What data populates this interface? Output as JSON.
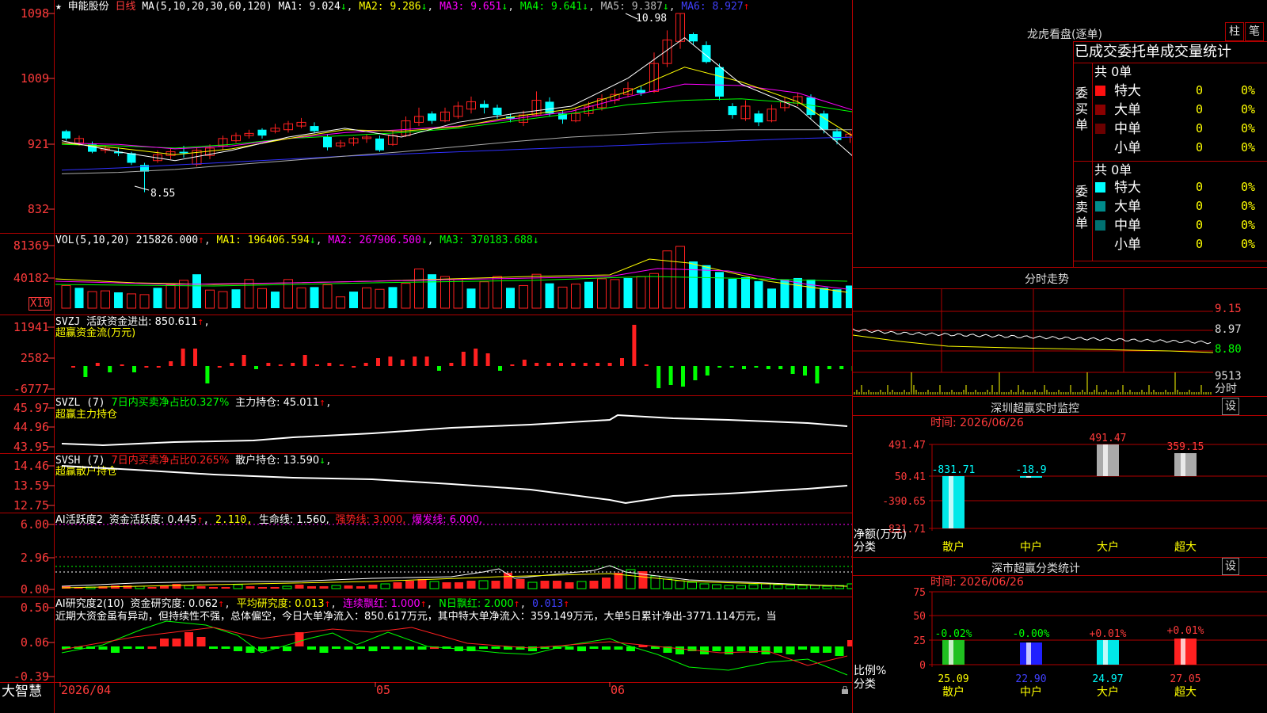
{
  "app": {
    "brand": "大智慧"
  },
  "main": {
    "star": "★",
    "stock_name": "申能股份",
    "period": "日线",
    "ma_label": "MA(5,10,20,30,60,120)",
    "ma1": "MA1: 9.024",
    "ma2": "MA2: 9.286",
    "ma3": "MA3: 9.651",
    "ma4": "MA4: 9.641",
    "ma5": "MA5: 9.387",
    "ma6": "MA6: 8.927",
    "high_label": "10.98",
    "low_label": "8.55",
    "y_ticks": [
      "1098",
      "1009",
      "921",
      "832"
    ],
    "colors": {
      "up": "#ff2020",
      "down": "#00ffff",
      "ma1": "#ffffff",
      "ma2": "#ffff00",
      "ma3": "#ff00ff",
      "ma4": "#00ff00",
      "ma5": "#aaaaaa",
      "ma6": "#3030ff"
    }
  },
  "vol": {
    "label": "VOL(5,10,20)",
    "value": "215826.000",
    "ma1": "MA1: 196406.594",
    "ma2": "MA2: 267906.500",
    "ma3": "MA3: 370183.688",
    "y_ticks": [
      "81369",
      "40182"
    ],
    "unit": "X10"
  },
  "svzj": {
    "label": "SVZJ",
    "desc": "活跃资金进出: 850.611",
    "subtitle": "超赢资金流(万元)",
    "y_ticks": [
      "11941",
      "2582",
      "-6777"
    ]
  },
  "svzl": {
    "label": "SVZL (7)",
    "desc": "7日内买卖净占比0.327%",
    "hold": "主力持仓: 45.011",
    "subtitle": "超赢主力持仓",
    "y_ticks": [
      "45.97",
      "44.96",
      "43.95"
    ]
  },
  "svsh": {
    "label": "SVSH (7)",
    "desc": "7日内买卖净占比0.265%",
    "hold": "散户持仓: 13.590",
    "subtitle": "超赢散户持仓",
    "y_ticks": [
      "14.46",
      "13.59",
      "12.75"
    ]
  },
  "ai1": {
    "label": "AI活跃度2",
    "desc": "资金活跃度: 0.445",
    "v2": "2.110,",
    "life": "生命线: 1.560,",
    "strong": "强势线: 3.000,",
    "burst": "爆发线: 6.000,",
    "y_ticks": [
      "6.00",
      "2.96",
      "0.00"
    ]
  },
  "ai2": {
    "label": "AI研究度2(10)",
    "desc": "资金研究度: 0.062",
    "avg": "平均研究度: 0.013",
    "cont": "连续飘红: 1.000",
    "nday": "N日飘红: 2.000",
    "last": "0.013",
    "comment": "近期大资金虽有异动，但持续性不强，总体偏空，今日大单净流入：850.617万元，其中特大单净流入：359.149万元，大单5日累计净出-3771.114万元，当",
    "y_ticks": [
      "0.50",
      "0.06",
      "-0.39"
    ]
  },
  "xaxis": {
    "labels": [
      "2026/04",
      "05",
      "06"
    ]
  },
  "right": {
    "lhb": {
      "title": "龙虎看盘(逐单)",
      "tab1": "柱",
      "tab2": "笔",
      "header": "已成交委托单成交量统计",
      "buy_side": "委买单",
      "sell_side": "委卖单",
      "buy_total": "共 0单",
      "sell_total": "共 0单",
      "rows": [
        {
          "name": "特大",
          "count": "0",
          "pct": "0%"
        },
        {
          "name": "大单",
          "count": "0",
          "pct": "0%"
        },
        {
          "name": "中单",
          "count": "0",
          "pct": "0%"
        },
        {
          "name": "小单",
          "count": "0",
          "pct": "0%"
        }
      ]
    },
    "intraday": {
      "title": "分时走势",
      "prices": [
        "9.15",
        "8.97",
        "8.80"
      ],
      "vol": "9513",
      "unit": "分时"
    },
    "monitor": {
      "title": "深圳超赢实时监控",
      "btn": "设",
      "time": "时间: 2026/06/26",
      "y_ticks": [
        "491.47",
        "50.41",
        "-390.65",
        "-831.71"
      ],
      "y_title": "净额(万元)",
      "x_title": "分类",
      "categories": [
        "散户",
        "中户",
        "大户",
        "超大"
      ],
      "values": [
        "-831.71",
        "-18.9",
        "491.47",
        "359.15"
      ]
    },
    "classify": {
      "title": "深市超赢分类统计",
      "btn": "设",
      "time": "时间: 2026/06/26",
      "y_ticks": [
        "75",
        "50",
        "25",
        "0"
      ],
      "y_title": "比例%",
      "x_title": "分类",
      "categories": [
        "散户",
        "中户",
        "大户",
        "超大"
      ],
      "changes": [
        "-0.02%",
        "-0.00%",
        "+0.01%",
        "+0.01%"
      ],
      "values": [
        "25.09",
        "22.90",
        "24.97",
        "27.05"
      ]
    }
  },
  "chart_data": {
    "type": "bar",
    "title": "申能股份 日线",
    "categories": [
      "散户",
      "中户",
      "大户",
      "超大"
    ],
    "series": [
      {
        "name": "净额(万元)",
        "values": [
          -831.71,
          -18.9,
          491.47,
          359.15
        ]
      },
      {
        "name": "比例%",
        "values": [
          25.09,
          22.9,
          24.97,
          27.05
        ]
      }
    ],
    "price_range": [
      8.32,
      10.98
    ],
    "last_price_high": 10.98,
    "last_price_low": 8.55
  }
}
